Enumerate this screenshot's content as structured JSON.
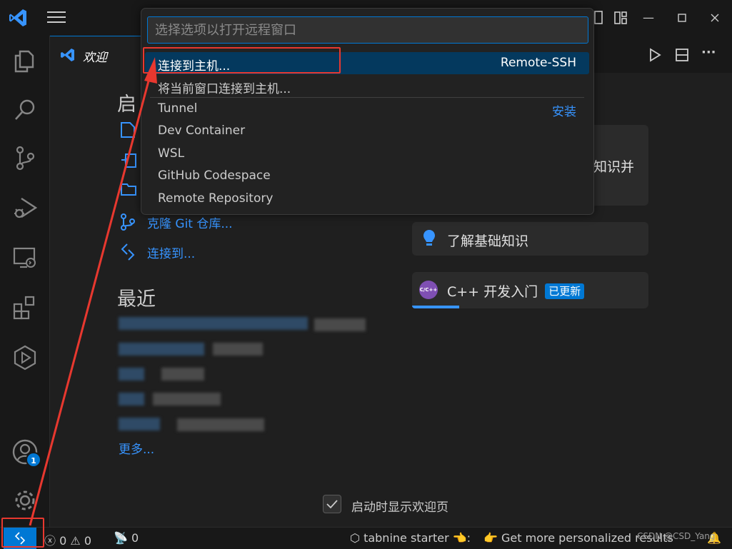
{
  "quick_pick": {
    "placeholder": "选择选项以打开远程窗口",
    "items": [
      {
        "label": "连接到主机...",
        "detail": "Remote-SSH"
      },
      {
        "label": "将当前窗口连接到主机..."
      },
      {
        "label": "Tunnel",
        "detail": "安装"
      },
      {
        "label": "Dev Container"
      },
      {
        "label": "WSL"
      },
      {
        "label": "GitHub Codespace"
      },
      {
        "label": "Remote Repository"
      }
    ]
  },
  "tab": {
    "label": "欢迎"
  },
  "welcome": {
    "start_heading": "启动",
    "start_heading_visible": "启",
    "start_links": [
      {
        "label": "克隆 Git 仓库..."
      },
      {
        "label": "连接到..."
      }
    ],
    "recent_heading": "最近",
    "more_label": "更多...",
    "walkthroughs": [
      {
        "title": "知识并",
        "partial": true
      },
      {
        "title": "了解基础知识"
      },
      {
        "title": "C++ 开发入门",
        "badge": "已更新",
        "icon_text": "C/C++",
        "progress_percent": 20
      }
    ],
    "show_on_startup": {
      "label": "启动时显示欢迎页",
      "checked": true
    }
  },
  "activity_bar": {
    "accounts_badge": "1"
  },
  "status_bar": {
    "errors": "0",
    "warnings": "0",
    "ports": "0",
    "tabnine": "tabnine starter",
    "tabnine_emoji": "👈:",
    "personalized": "Get more personalized results",
    "personalized_emoji": "👉"
  },
  "watermark": "CSDN @CSD_Yang",
  "colors": {
    "accent": "#0078d4",
    "link": "#3794ff",
    "selection": "#04395e",
    "annotation": "#e8382f"
  }
}
